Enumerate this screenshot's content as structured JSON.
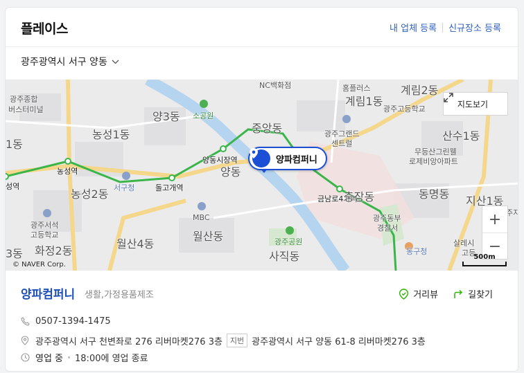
{
  "header": {
    "title": "플레이스",
    "link_register_business": "내 업체 등록",
    "link_register_new_place": "신규장소 등록"
  },
  "region_selector": {
    "label": "광주광역시 서구 양동"
  },
  "map": {
    "view_map_button": "지도보기",
    "zoom_in": "+",
    "zoom_out": "−",
    "copyright": "© NAVER Corp.",
    "scale_label": "500m",
    "pin_label": "양파컴퍼니",
    "labels": {
      "nc_west": "NC백화점",
      "homeplus": "홈플러스",
      "gyerim2": "계림2동",
      "gwangju_terminal_1": "광주종합",
      "gwangju_terminal_2": "버스터미널",
      "yang3": "양3동",
      "sogongwon": "소공원",
      "gyerim1": "계림1동",
      "gwangju_high": "광주고등학교",
      "jungang": "중앙동",
      "nongseong1": "농성1동",
      "dong1_left": "1동",
      "gwangju_grand_1": "광주그랜드",
      "gwangju_grand_2": "센트럴",
      "sansu1": "산수1동",
      "mudeung_1": "무등산그린웰",
      "mudeung_2": "로제비앙아파트",
      "yangdong_market": "양동시장역",
      "yangdong": "양동",
      "nongseong_station": "농성역",
      "station_left": "성역",
      "seogu_office": "서구청",
      "dolgogae": "돌고개역",
      "nongseong2": "농성2동",
      "geumnamro4": "금남로4가역",
      "chungjang": "충장동",
      "dongmyeong": "동명동",
      "jisan1": "지산1동",
      "mbc": "MBC",
      "wolsan": "월산동",
      "gwangju_dongbu_1": "광주동부",
      "gwangju_dongbu_2": "경찰서",
      "seoseok_1": "광주서석",
      "seoseok_2": "고등학교",
      "wolsan4": "월산4동",
      "gwangju_park": "광주공원",
      "dong3_left": "3동",
      "hwajeong2": "화정2동",
      "sajik": "사직동",
      "donggu_office": "동구청",
      "salesian_1": "살레시",
      "salesian_2": "고등",
      "ju_right": "주지"
    }
  },
  "place": {
    "name": "양파컴퍼니",
    "category": "생활,가정용품제조",
    "action_distance_view": "거리뷰",
    "action_directions": "길찾기",
    "phone": "0507-1394-1475",
    "address": "광주광역시 서구 천변좌로 276 리버마켓276 3층",
    "jibun_tag": "지번",
    "jibun_address": "광주광역시 서구 양동 61-8 리버마켓276 3층",
    "status": "영업 중",
    "hours": "18:00에 영업 종료"
  },
  "colors": {
    "accent_blue": "#1d4fb9",
    "subway_green": "#3ab54a",
    "pin_blue": "#1a4fd6"
  }
}
